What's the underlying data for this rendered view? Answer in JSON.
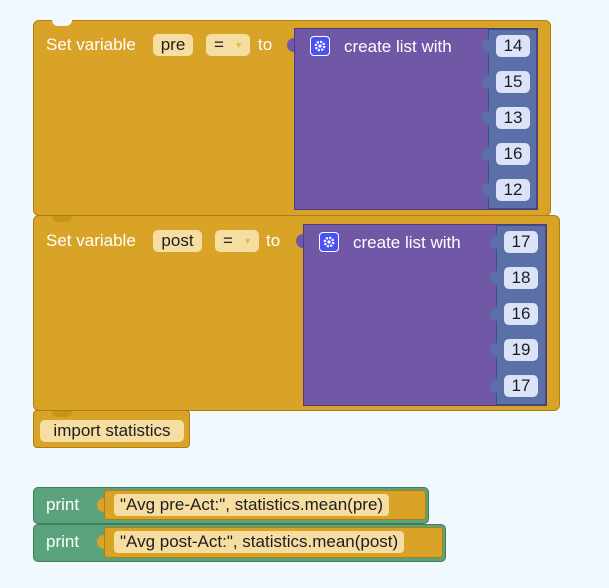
{
  "block1": {
    "prefix": "Set variable",
    "var_name": "pre",
    "operator": "=",
    "to_label": "to",
    "list_label": "create list with",
    "items": [
      "14",
      "15",
      "13",
      "16",
      "12"
    ]
  },
  "block2": {
    "prefix": "Set variable",
    "var_name": "post",
    "operator": "=",
    "to_label": "to",
    "list_label": "create list with",
    "items": [
      "17",
      "18",
      "16",
      "19",
      "17"
    ]
  },
  "import_block": {
    "label": "import statistics"
  },
  "print_blocks": [
    {
      "label": "print",
      "value": "\"Avg pre-Act:\", statistics.mean(pre)"
    },
    {
      "label": "print",
      "value": "\"Avg post-Act:\", statistics.mean(post)"
    }
  ],
  "colors": {
    "background": "#f1f8fe",
    "variable_block": "#d8a326",
    "list_block": "#7158a6",
    "number_slot": "#5b6fa8",
    "print_block": "#5aa37c",
    "field": "#f6dda1"
  }
}
